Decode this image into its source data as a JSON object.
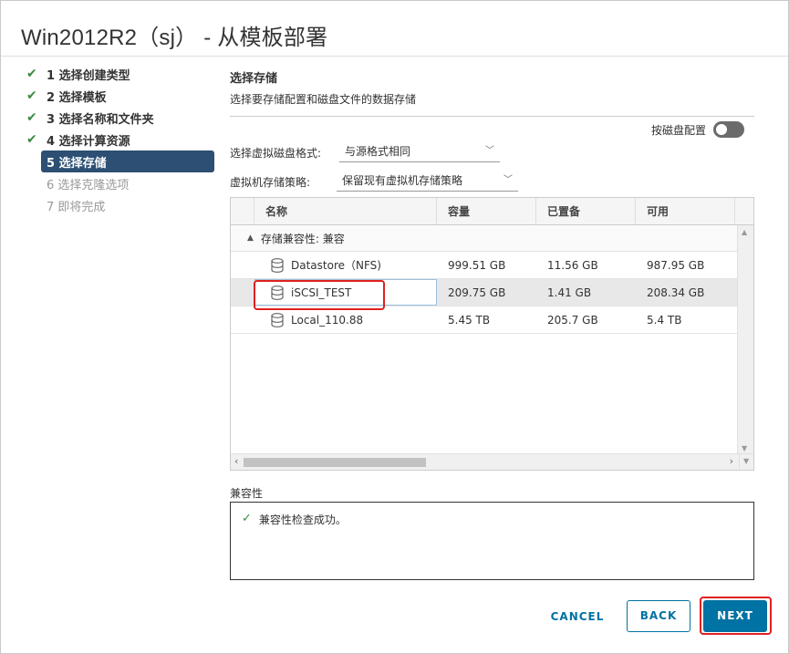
{
  "dialog": {
    "title": "Win2012R2（sj） - 从模板部署"
  },
  "steps": [
    {
      "label": "1 选择创建类型",
      "state": "done"
    },
    {
      "label": "2 选择模板",
      "state": "done"
    },
    {
      "label": "3 选择名称和文件夹",
      "state": "done"
    },
    {
      "label": "4 选择计算资源",
      "state": "done"
    },
    {
      "label": "5 选择存储",
      "state": "active"
    },
    {
      "label": "6 选择克隆选项",
      "state": "disabled"
    },
    {
      "label": "7 即将完成",
      "state": "disabled"
    }
  ],
  "section": {
    "title": "选择存储",
    "subtitle": "选择要存储配置和磁盘文件的数据存储"
  },
  "per_disk": {
    "label": "按磁盘配置",
    "enabled": false
  },
  "disk_format": {
    "label": "选择虚拟磁盘格式:",
    "value": "与源格式相同"
  },
  "storage_policy": {
    "label": "虚拟机存储策略:",
    "value": "保留现有虚拟机存储策略"
  },
  "grid": {
    "columns": [
      "名称",
      "容量",
      "已置备",
      "可用"
    ],
    "group_label": "存储兼容性: 兼容",
    "rows": [
      {
        "name": "Datastore（NFS)",
        "capacity": "999.51 GB",
        "provisioned": "11.56 GB",
        "free": "987.95 GB",
        "selected": false
      },
      {
        "name": "iSCSI_TEST",
        "capacity": "209.75 GB",
        "provisioned": "1.41 GB",
        "free": "208.34 GB",
        "selected": true
      },
      {
        "name": "Local_110.88",
        "capacity": "5.45 TB",
        "provisioned": "205.7 GB",
        "free": "5.4 TB",
        "selected": false
      }
    ]
  },
  "compatibility": {
    "label": "兼容性",
    "message": "兼容性检查成功。"
  },
  "footer": {
    "cancel_label": "CANCEL",
    "back_label": "BACK",
    "next_label": "NEXT"
  },
  "colors": {
    "active_step": "#2c4f73",
    "primary": "#0072a3",
    "success": "#3b8b3f",
    "highlight": "#e02020"
  }
}
